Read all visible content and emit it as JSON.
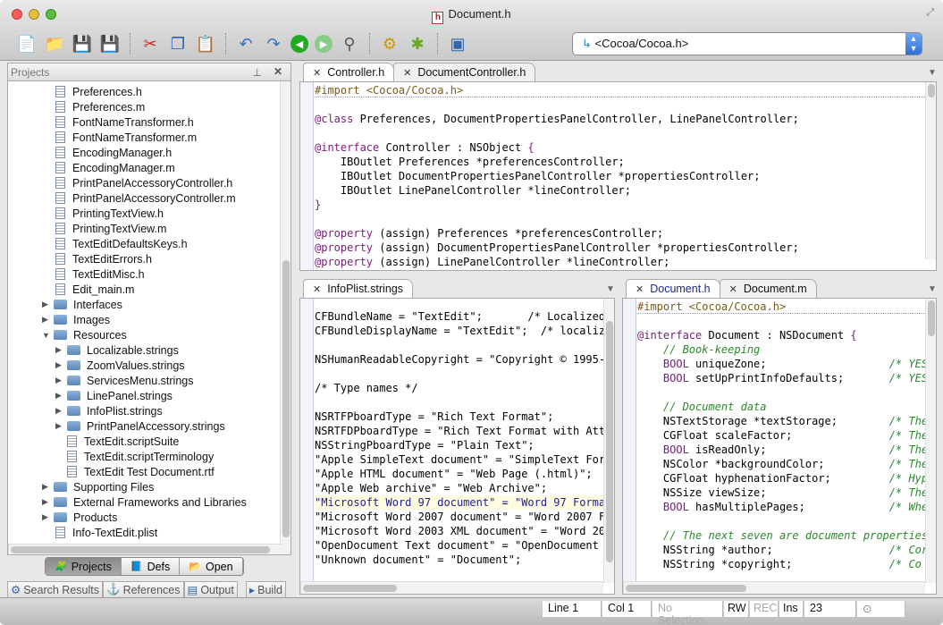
{
  "window": {
    "title": "Document.h"
  },
  "toolbar": {
    "buttons": [
      "new-file",
      "open",
      "save",
      "save-all",
      "cut",
      "copy",
      "paste",
      "undo",
      "redo",
      "back",
      "forward",
      "find",
      "settings",
      "debug",
      "preview"
    ],
    "symbol_combo": "<Cocoa/Cocoa.h>"
  },
  "projects": {
    "title": "Projects",
    "items": [
      {
        "label": "Preferences.h",
        "type": "file",
        "depth": 0
      },
      {
        "label": "Preferences.m",
        "type": "file",
        "depth": 0
      },
      {
        "label": "FontNameTransformer.h",
        "type": "file",
        "depth": 0
      },
      {
        "label": "FontNameTransformer.m",
        "type": "file",
        "depth": 0
      },
      {
        "label": "EncodingManager.h",
        "type": "file",
        "depth": 0
      },
      {
        "label": "EncodingManager.m",
        "type": "file",
        "depth": 0
      },
      {
        "label": "PrintPanelAccessoryController.h",
        "type": "file",
        "depth": 0
      },
      {
        "label": "PrintPanelAccessoryController.m",
        "type": "file",
        "depth": 0
      },
      {
        "label": "PrintingTextView.h",
        "type": "file",
        "depth": 0
      },
      {
        "label": "PrintingTextView.m",
        "type": "file",
        "depth": 0
      },
      {
        "label": "TextEditDefaultsKeys.h",
        "type": "file",
        "depth": 0
      },
      {
        "label": "TextEditErrors.h",
        "type": "file",
        "depth": 0
      },
      {
        "label": "TextEditMisc.h",
        "type": "file",
        "depth": 0
      },
      {
        "label": "Edit_main.m",
        "type": "file",
        "depth": 0
      },
      {
        "label": "Interfaces",
        "type": "folder",
        "depth": 1,
        "expanded": false
      },
      {
        "label": "Images",
        "type": "folder",
        "depth": 1,
        "expanded": false
      },
      {
        "label": "Resources",
        "type": "folder",
        "depth": 1,
        "expanded": true
      },
      {
        "label": "Localizable.strings",
        "type": "folder",
        "depth": 2,
        "expanded": false
      },
      {
        "label": "ZoomValues.strings",
        "type": "folder",
        "depth": 2,
        "expanded": false
      },
      {
        "label": "ServicesMenu.strings",
        "type": "folder",
        "depth": 2,
        "expanded": false
      },
      {
        "label": "LinePanel.strings",
        "type": "folder",
        "depth": 2,
        "expanded": false
      },
      {
        "label": "InfoPlist.strings",
        "type": "folder",
        "depth": 2,
        "expanded": false
      },
      {
        "label": "PrintPanelAccessory.strings",
        "type": "folder",
        "depth": 2,
        "expanded": false
      },
      {
        "label": "TextEdit.scriptSuite",
        "type": "file",
        "depth": 2
      },
      {
        "label": "TextEdit.scriptTerminology",
        "type": "file",
        "depth": 2
      },
      {
        "label": "TextEdit Test Document.rtf",
        "type": "file",
        "depth": 2
      },
      {
        "label": "Supporting Files",
        "type": "folder",
        "depth": 1,
        "expanded": false
      },
      {
        "label": "External Frameworks and Libraries",
        "type": "folder",
        "depth": 1,
        "expanded": false
      },
      {
        "label": "Products",
        "type": "folder",
        "depth": 1,
        "expanded": false
      },
      {
        "label": "Info-TextEdit.plist",
        "type": "file",
        "depth": 0
      }
    ],
    "segments": [
      {
        "label": "Projects",
        "active": true
      },
      {
        "label": "Defs",
        "active": false
      },
      {
        "label": "Open",
        "active": false
      }
    ]
  },
  "editor_top": {
    "tabs": [
      {
        "label": "Controller.h",
        "active": true
      },
      {
        "label": "DocumentController.h",
        "active": false
      }
    ],
    "lines": [
      [
        [
          "#import ",
          "pp"
        ],
        [
          "<Cocoa/Cocoa.h>",
          "pp"
        ]
      ],
      [],
      [
        [
          "@class",
          "kw"
        ],
        [
          " Preferences, DocumentPropertiesPanelController, LinePanelController;",
          ""
        ]
      ],
      [],
      [
        [
          "@interface",
          "kw"
        ],
        [
          " Controller : NSObject ",
          ""
        ],
        [
          "{",
          "kw"
        ]
      ],
      [
        [
          "    IBOutlet Preferences *preferencesController;",
          ""
        ]
      ],
      [
        [
          "    IBOutlet DocumentPropertiesPanelController *propertiesController;",
          ""
        ]
      ],
      [
        [
          "    IBOutlet LinePanelController *lineController;",
          ""
        ]
      ],
      [
        [
          "}",
          "kw"
        ]
      ],
      [],
      [
        [
          "@property",
          "kw"
        ],
        [
          " (assign) Preferences *preferencesController;",
          ""
        ]
      ],
      [
        [
          "@property",
          "kw"
        ],
        [
          " (assign) DocumentPropertiesPanelController *propertiesController;",
          ""
        ]
      ],
      [
        [
          "@property",
          "kw"
        ],
        [
          " (assign) LinePanelController *lineController;",
          ""
        ]
      ]
    ]
  },
  "editor_left": {
    "tabs": [
      {
        "label": "InfoPlist.strings",
        "active": true
      }
    ],
    "lines": [
      [],
      [
        [
          "CFBundleName = \"TextEdit\";       /* Localized \"",
          ""
        ]
      ],
      [
        [
          "CFBundleDisplayName = \"TextEdit\";  /* localiz",
          ""
        ]
      ],
      [],
      [
        [
          "NSHumanReadableCopyright = \"Copyright © 1995-2",
          ""
        ]
      ],
      [],
      [
        [
          "/* Type names */",
          ""
        ]
      ],
      [],
      [
        [
          "NSRTFPboardType = \"Rich Text Format\";",
          ""
        ]
      ],
      [
        [
          "NSRTFDPboardType = \"Rich Text Format with Attc",
          ""
        ]
      ],
      [
        [
          "NSStringPboardType = \"Plain Text\";",
          ""
        ]
      ],
      [
        [
          "\"Apple SimpleText document\" = \"SimpleText Form",
          ""
        ]
      ],
      [
        [
          "\"Apple HTML document\" = \"Web Page (.html)\";",
          ""
        ]
      ],
      [
        [
          "\"Apple Web archive\" = \"Web Archive\";",
          ""
        ]
      ],
      [
        [
          "\"Microsoft Word 97 document\" = \"Word 97 Format",
          ""
        ]
      ],
      [
        [
          "\"Microsoft Word 2007 document\" = \"Word 2007 Fo",
          ""
        ]
      ],
      [
        [
          "\"Microsoft Word 2003 XML document\" = \"Word 200",
          ""
        ]
      ],
      [
        [
          "\"OpenDocument Text document\" = \"OpenDocument T",
          ""
        ]
      ],
      [
        [
          "\"Unknown document\" = \"Document\";",
          ""
        ]
      ]
    ]
  },
  "editor_right": {
    "tabs": [
      {
        "label": "Document.h",
        "active": true
      },
      {
        "label": "Document.m",
        "active": false
      }
    ],
    "lines": [
      [
        [
          "#import ",
          "pp"
        ],
        [
          "<Cocoa/Cocoa.h>",
          "pp"
        ]
      ],
      [],
      [
        [
          "@interface",
          "kw"
        ],
        [
          " Document : NSDocument ",
          ""
        ],
        [
          "{",
          "kw"
        ]
      ],
      [
        [
          "    ",
          ""
        ],
        [
          "// Book-keeping",
          "cm"
        ]
      ],
      [
        [
          "    ",
          ""
        ],
        [
          "BOOL",
          "kw"
        ],
        [
          " uniqueZone;                   ",
          ""
        ],
        [
          "/* YES",
          "cm"
        ]
      ],
      [
        [
          "    ",
          ""
        ],
        [
          "BOOL",
          "kw"
        ],
        [
          " setUpPrintInfoDefaults;       ",
          ""
        ],
        [
          "/* YES",
          "cm"
        ]
      ],
      [],
      [
        [
          "    ",
          ""
        ],
        [
          "// Document data",
          "cm"
        ]
      ],
      [
        [
          "    NSTextStorage *textStorage;        ",
          ""
        ],
        [
          "/* The",
          "cm"
        ]
      ],
      [
        [
          "    CGFloat scaleFactor;               ",
          ""
        ],
        [
          "/* The",
          "cm"
        ]
      ],
      [
        [
          "    ",
          ""
        ],
        [
          "BOOL",
          "kw"
        ],
        [
          " isReadOnly;                   ",
          ""
        ],
        [
          "/* The",
          "cm"
        ]
      ],
      [
        [
          "    NSColor *backgroundColor;          ",
          ""
        ],
        [
          "/* The",
          "cm"
        ]
      ],
      [
        [
          "    CGFloat hyphenationFactor;         ",
          ""
        ],
        [
          "/* Hyp",
          "cm"
        ]
      ],
      [
        [
          "    NSSize viewSize;                   ",
          ""
        ],
        [
          "/* The",
          "cm"
        ]
      ],
      [
        [
          "    ",
          ""
        ],
        [
          "BOOL",
          "kw"
        ],
        [
          " hasMultiplePages;             ",
          ""
        ],
        [
          "/* Whe",
          "cm"
        ]
      ],
      [],
      [
        [
          "    ",
          ""
        ],
        [
          "// The next seven are document properties",
          "cm"
        ]
      ],
      [
        [
          "    NSString *author;                  ",
          ""
        ],
        [
          "/* Cor",
          "cm"
        ]
      ],
      [
        [
          "    NSString *copyright;               ",
          ""
        ],
        [
          "/* Co",
          "cm"
        ]
      ]
    ]
  },
  "bottom_tabs": [
    "Search Results",
    "References",
    "Output",
    "Build"
  ],
  "status": {
    "line": "Line 1",
    "col": "Col 1",
    "selection": "No Selection",
    "rw": "RW",
    "rec": "REC",
    "ins": "Ins",
    "value": "23"
  },
  "colors": {
    "keyword": "#7a1a7a",
    "comment": "#2a8a2a",
    "preprocessor": "#7a5a1a",
    "accent": "#2f6fd6"
  }
}
